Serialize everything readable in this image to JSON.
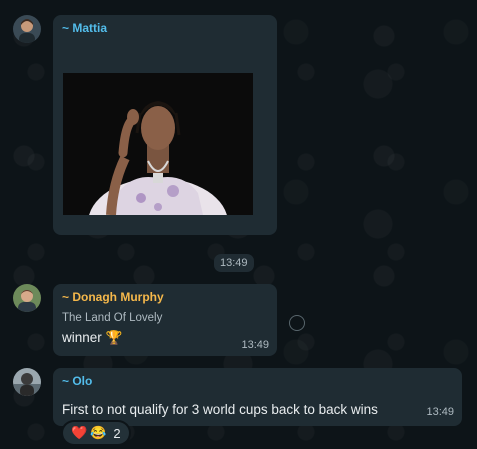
{
  "messages": [
    {
      "sender": "~ Mattia",
      "sender_color": "#53bdeb",
      "type": "gif",
      "time": "13:49"
    },
    {
      "sender": "~ Donagh Murphy",
      "sender_color": "#f5b84b",
      "subtitle": "The Land Of Lovely",
      "text": "winner 🏆",
      "time": "13:49"
    },
    {
      "sender": "~ Olo",
      "sender_color": "#53bdeb",
      "text": "First to not qualify for 3 world cups back to back wins",
      "time": "13:49",
      "reactions": {
        "emojis": [
          "❤️",
          "😂"
        ],
        "count": "2"
      }
    }
  ],
  "icons": {
    "heart": "heart-icon",
    "laugh": "laughing-emoji-icon",
    "trophy": "trophy-icon"
  }
}
